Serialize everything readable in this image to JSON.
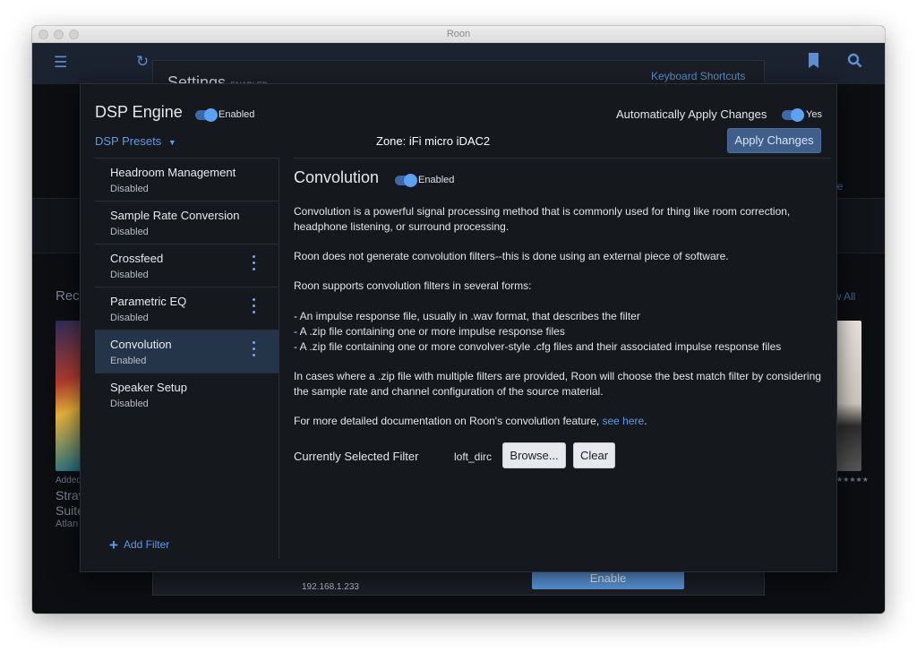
{
  "window": {
    "title": "Roon"
  },
  "background": {
    "settings_title": "Settings",
    "settings_title_suffix": "ENABLED",
    "keyboard_shortcuts": "Keyboard Shortcuts",
    "ip_address": "192.168.1.233",
    "enable_button": "Enable",
    "recent_partial": "Rece",
    "view_all_partial": "ew All",
    "album_added_partial": "Added",
    "album_title_line1": "Strav",
    "album_title_line2": "Suite",
    "album_artist_partial": "Atlan",
    "partial_link": "le",
    "rating_partial": "★★★★★"
  },
  "dsp": {
    "title": "DSP Engine",
    "enabled_label": "Enabled",
    "auto_apply_label": "Automatically Apply Changes",
    "auto_apply_value": "Yes",
    "presets_label": "DSP Presets",
    "presets_caret": "▼",
    "zone": "Zone: iFi micro iDAC2",
    "apply_button": "Apply Changes",
    "add_filter": "Add Filter",
    "filters": [
      {
        "name": "Headroom Management",
        "status": "Disabled"
      },
      {
        "name": "Sample Rate Conversion",
        "status": "Disabled"
      },
      {
        "name": "Crossfeed",
        "status": "Disabled"
      },
      {
        "name": "Parametric EQ",
        "status": "Disabled"
      },
      {
        "name": "Convolution",
        "status": "Enabled"
      },
      {
        "name": "Speaker Setup",
        "status": "Disabled"
      }
    ],
    "content": {
      "title": "Convolution",
      "enabled_label": "Enabled",
      "p1": "Convolution is a powerful signal processing method that is commonly used for thing like room correction, headphone listening, or surround processing.",
      "p2": "Roon does not generate convolution filters--this is done using an external piece of software.",
      "p3": "Roon supports convolution filters in several forms:",
      "list1": "- An impulse response file, usually in .wav format, that describes the filter",
      "list2": "- A .zip file containing one or more impulse response files",
      "list3": "- A .zip file containing one or more convolver-style .cfg files and their associated impulse response files",
      "p4": "In cases where a .zip file with multiple filters are provided, Roon will choose the best match filter by considering the sample rate and channel configuration of the source material.",
      "p5_prefix": "For more detailed documentation on Roon's convolution feature, ",
      "p5_link": "see here",
      "p5_suffix": ".",
      "filter_label": "Currently Selected Filter",
      "filter_value": "loft_dirc",
      "browse_button": "Browse...",
      "clear_button": "Clear"
    }
  },
  "colors": {
    "accent": "#5b9be8",
    "dialog_bg": "#15181d",
    "active_item_bg": "#253549",
    "apply_button_bg": "#3f5f8a"
  }
}
